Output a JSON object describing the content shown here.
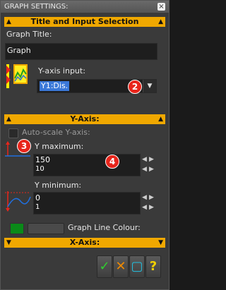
{
  "window": {
    "title": "GRAPH SETTINGS:",
    "close_label": "×"
  },
  "section_title_input": {
    "label": "Title and Input Selection",
    "left_arrow": "▲",
    "right_arrow": "▲"
  },
  "graph_title": {
    "label": "Graph Title:",
    "value": "Graph"
  },
  "y_input": {
    "label": "Y-axis input:",
    "value": "Y1:Dis.",
    "dropdown_icon": "▼"
  },
  "section_y_axis": {
    "label": "Y-Axis:",
    "left_arrow": "▲",
    "right_arrow": "▲"
  },
  "autoscale": {
    "label": "Auto-scale Y-axis:"
  },
  "y_max": {
    "label": "Y maximum:",
    "value": "150",
    "step": "10"
  },
  "y_min": {
    "label": "Y minimum:",
    "value": "0",
    "step": "1"
  },
  "line_colour": {
    "label": "Graph Line Colour:",
    "color": "#0a8a18"
  },
  "section_x_axis": {
    "label": "X-Axis:",
    "left_arrow": "▼",
    "right_arrow": "▼"
  },
  "buttons": {
    "ok": "✓",
    "cancel": "✕",
    "doc": "▢",
    "help": "?"
  },
  "badges": {
    "b2": "2",
    "b3": "3",
    "b4": "4"
  },
  "spinner_glyphs": {
    "left": "◀",
    "right": "▶"
  }
}
